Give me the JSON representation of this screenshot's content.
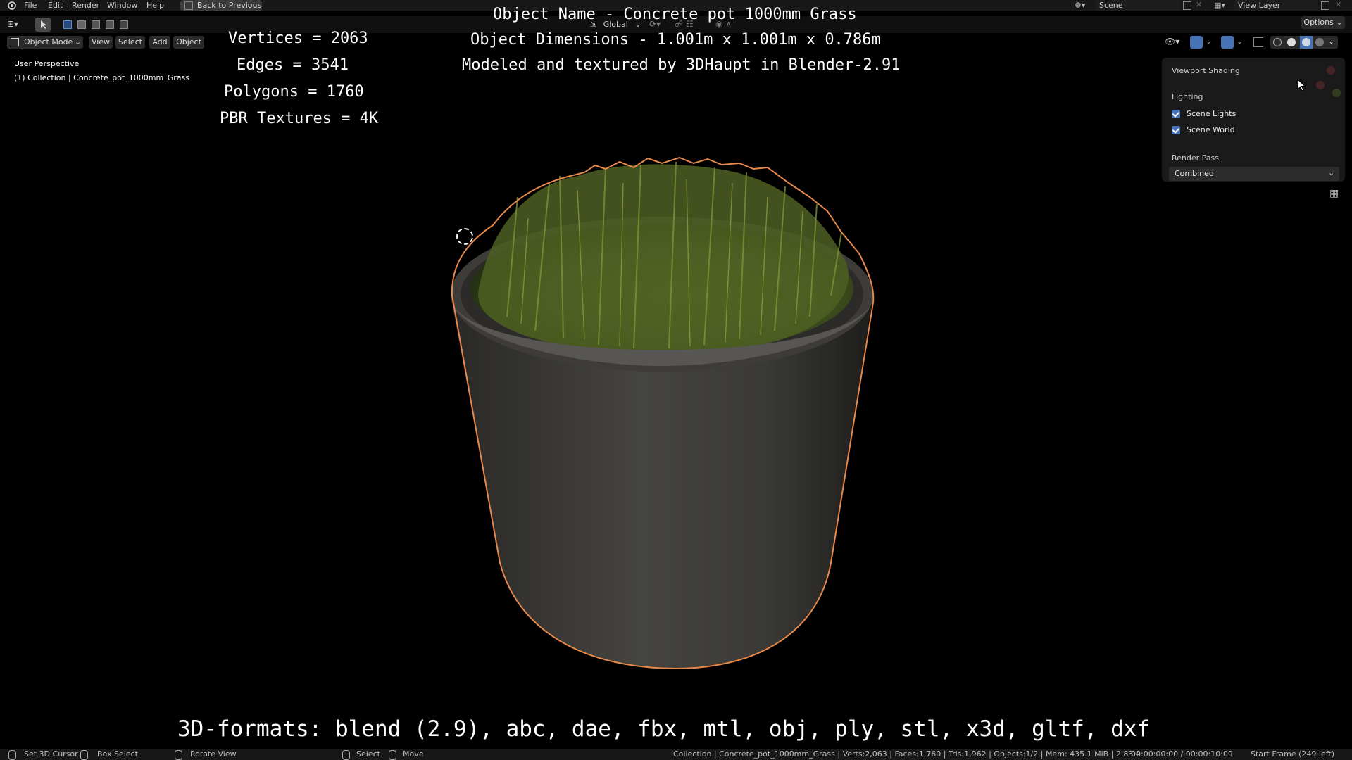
{
  "menu": {
    "items": [
      "File",
      "Edit",
      "Render",
      "Window",
      "Help"
    ],
    "back_label": "Back to Previous",
    "scene": "Scene",
    "view_layer": "View Layer",
    "options": "Options"
  },
  "header": {
    "mode": "Object Mode",
    "view": "View",
    "select": "Select",
    "add": "Add",
    "object": "Object",
    "transform": "Global"
  },
  "overlay": {
    "vertices": "Vertices = 2063",
    "edges": "Edges = 3541",
    "polygons": "Polygons = 1760",
    "textures": "PBR Textures = 4K",
    "object_name": "Object Name - Concrete pot 1000mm Grass",
    "dimensions": "Object Dimensions -  1.001m x 1.001m x 0.786m",
    "credits": "Modeled and textured by 3DHaupt in Blender-2.91",
    "formats": "3D-formats: blend (2.9), abc, dae, fbx, mtl, obj, ply, stl, x3d, gltf, dxf"
  },
  "viewport": {
    "perspective": "User Perspective",
    "collection": "(1) Collection | Concrete_pot_1000mm_Grass"
  },
  "shading_panel": {
    "title": "Viewport Shading",
    "lighting": "Lighting",
    "scene_lights": "Scene Lights",
    "scene_world": "Scene World",
    "render_pass": "Render Pass",
    "render_pass_value": "Combined"
  },
  "statusbar": {
    "set_cursor": "Set 3D Cursor",
    "box_select": "Box Select",
    "rotate_view": "Rotate View",
    "select": "Select",
    "move": "Move",
    "stats": "Collection | Concrete_pot_1000mm_Grass | Verts:2,063 | Faces:1,760 | Tris:1,962 | Objects:1/2 | Mem: 435.1 MiB | 2.83.4",
    "time": "00:00:00:00 / 00:00:10:09",
    "frame": "Start Frame (249 left)"
  },
  "colors": {
    "background": "#000000",
    "outline": "#e8894a",
    "checkbox": "#4772b3"
  }
}
